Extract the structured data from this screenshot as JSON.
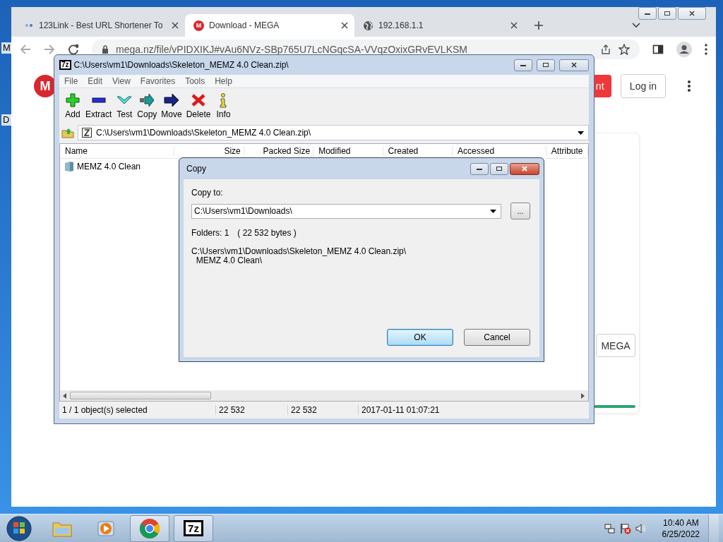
{
  "desktop": {
    "icon_labels": [
      "M",
      "D"
    ]
  },
  "browser": {
    "tabs": [
      {
        "title": "123Link - Best URL Shortener To",
        "selected": false,
        "kind": "link"
      },
      {
        "title": "Download - MEGA",
        "selected": true,
        "kind": "mega",
        "logo_letter": "M"
      },
      {
        "title": "192.168.1.1",
        "selected": false,
        "kind": "globe"
      }
    ],
    "url": "mega.nz/file/vPIDXIKJ#vAu6NVz-SBp765U7LcNGqcSA-VVqzOxixGRvEVLKSM",
    "page": {
      "logo_letter": "M",
      "primary_button": "nt",
      "login_button": "Log in",
      "card_button": "MEGA",
      "progress": {
        "level": 1
      }
    }
  },
  "archive_window": {
    "icon_text": "7z",
    "title": "C:\\Users\\vm1\\Downloads\\Skeleton_MEMZ 4.0 Clean.zip\\",
    "menu": [
      "File",
      "Edit",
      "View",
      "Favorites",
      "Tools",
      "Help"
    ],
    "toolbar": [
      {
        "label": "Add",
        "kind": "add"
      },
      {
        "label": "Extract",
        "kind": "extract"
      },
      {
        "label": "Test",
        "kind": "test"
      },
      {
        "label": "Copy",
        "kind": "copy"
      },
      {
        "label": "Move",
        "kind": "move"
      },
      {
        "label": "Delete",
        "kind": "delete"
      },
      {
        "label": "Info",
        "kind": "info"
      }
    ],
    "path": "C:\\Users\\vm1\\Downloads\\Skeleton_MEMZ 4.0 Clean.zip\\",
    "columns": [
      "Name",
      "Size",
      "Packed Size",
      "Modified",
      "Created",
      "Accessed",
      "Attribute"
    ],
    "rows": [
      {
        "name": "MEMZ 4.0 Clean"
      }
    ],
    "status_bar": [
      "1 / 1 object(s) selected",
      "22 532",
      "22 532",
      "2017-01-11 01:07:21"
    ]
  },
  "copy_dialog": {
    "title": "Copy",
    "label": "Copy to:",
    "value": "C:\\Users\\vm1\\Downloads\\",
    "browse": "...",
    "summary": [
      "Folders: 1",
      "( 22 532 bytes )"
    ],
    "source_lines": [
      "C:\\Users\\vm1\\Downloads\\Skeleton_MEMZ 4.0 Clean.zip\\",
      "  MEMZ 4.0 Clean\\"
    ],
    "buttons": [
      {
        "label": "OK",
        "default": true
      },
      {
        "label": "Cancel",
        "default": false
      }
    ]
  },
  "taskbar": {
    "apps": [
      {
        "kind": "explorer",
        "running": false
      },
      {
        "kind": "media",
        "running": false
      },
      {
        "kind": "chrome",
        "running": true
      },
      {
        "kind": "archiver",
        "running": true,
        "text": "7z"
      }
    ],
    "clock": {
      "time": "10:40 AM",
      "date": "6/25/2022"
    }
  }
}
